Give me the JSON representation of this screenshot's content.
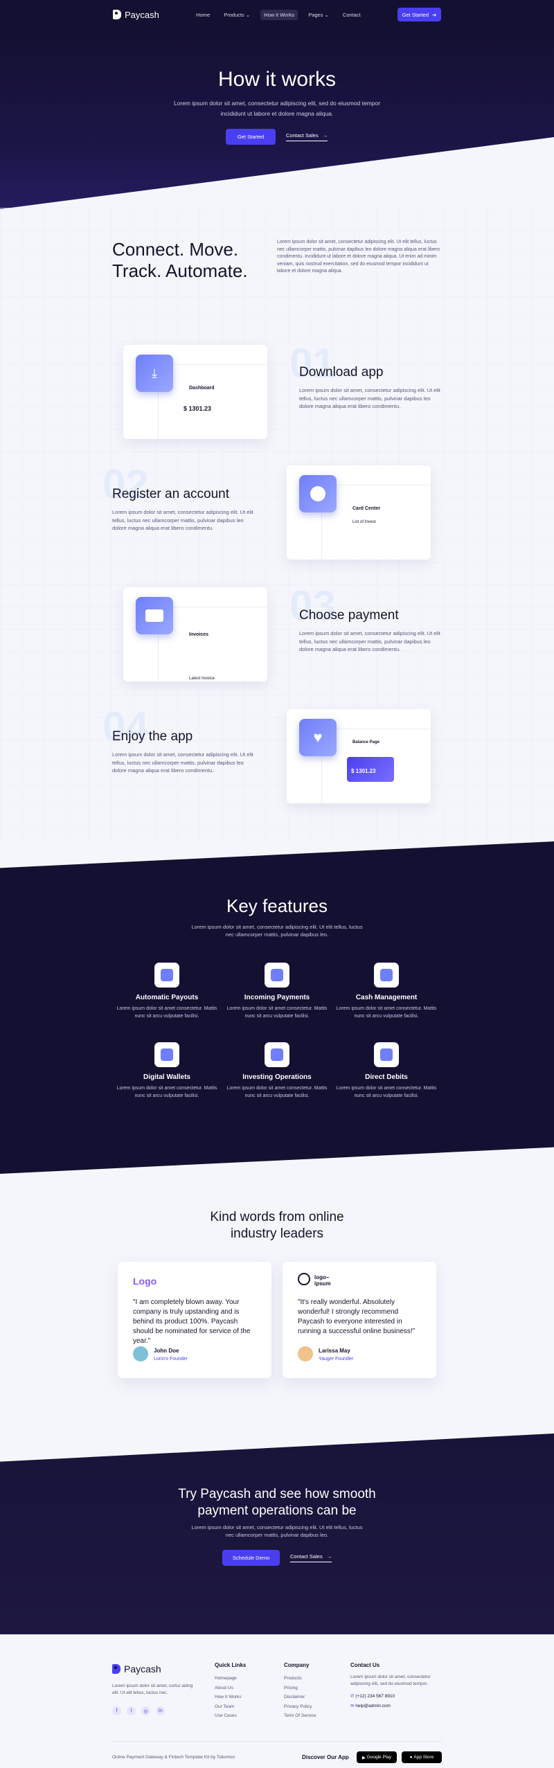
{
  "nav": {
    "brand": "Paycash",
    "items": [
      {
        "label": "Home"
      },
      {
        "label": "Products ⌄"
      },
      {
        "label": "How it Works"
      },
      {
        "label": "Pages ⌄"
      },
      {
        "label": "Contact"
      }
    ],
    "cta": "Get Started"
  },
  "hero": {
    "title": "How it works",
    "subtitle": "Lorem ipsum dolor sit amet, consectetur adipiscing elit, sed do eiusmod tempor incididunt ut labore et dolore magna aliqua.",
    "primary": "Get Started",
    "secondary": "Contact Sales"
  },
  "intro": {
    "title": "Connect. Move. Track. Automate.",
    "text": "Lorem ipsum dolor sit amet, consectetur adipiscing elit. Ut elit tellus, luctus nec ullamcorper mattis, pulvinar dapibus leo dolore magna aliqua erat libero condimentu. Incididunt ut labore et dolore magna aliqua. Ut enim ad minim veniam, quis nostrud exercitation, sed do eiusmod tempor incididunt ut labore et dolore magna aliqua."
  },
  "steps": [
    {
      "num": "01",
      "title": "Download app",
      "text": "Lorem ipsum dolor sit amet, consectetur adipiscing elit. Ut elit tellus, luctus nec ullamcorper mattis, pulvinar dapibus leo dolore magna aliqua erat libero condimentu.",
      "card_title": "Dashboard",
      "card_value": "$ 1301.23"
    },
    {
      "num": "02",
      "title": "Register an account",
      "text": "Lorem ipsum dolor sit amet, consectetur adipiscing elit. Ut elit tellus, luctus nec ullamcorper mattis, pulvinar dapibus leo dolore magna aliqua erat libero condimentu.",
      "card_title": "Card Center",
      "card_value": "List of Invest"
    },
    {
      "num": "03",
      "title": "Choose payment",
      "text": "Lorem ipsum dolor sit amet, consectetur adipiscing elit. Ut elit tellus, luctus nec ullamcorper mattis, pulvinar dapibus leo dolore magna aliqua erat libero condimentu.",
      "card_title": "Invoices",
      "card_value": "Latest Invoice"
    },
    {
      "num": "04",
      "title": "Enjoy the app",
      "text": "Lorem ipsum dolor sit amet, consectetur adipiscing elit. Ut elit tellus, luctus nec ullamcorper mattis, pulvinar dapibus leo dolore magna aliqua erat libero condimentu.",
      "card_title": "Balance Page",
      "card_value": "$ 1301.23"
    }
  ],
  "features": {
    "title": "Key features",
    "subtitle": "Lorem ipsum dolor sit amet, consectetur adipiscing elit. Ut elit tellus, luctus nec ullamcorper mattis, pulvinar dapibus leo.",
    "items": [
      {
        "title": "Automatic Payouts",
        "text": "Lorem ipsum dolor sit amet consectetur. Mattis nunc sit arcu vulputate facilisi."
      },
      {
        "title": "Incoming Payments",
        "text": "Lorem ipsum dolor sit amet consectetur. Mattis nunc sit arcu vulputate facilisi."
      },
      {
        "title": "Cash Management",
        "text": "Lorem ipsum dolor sit amet consectetur. Mattis nunc sit arcu vulputate facilisi."
      },
      {
        "title": "Digital Wallets",
        "text": "Lorem ipsum dolor sit amet consectetur. Mattis nunc sit arcu vulputate facilisi."
      },
      {
        "title": "Investing Operations",
        "text": "Lorem ipsum dolor sit amet consectetur. Mattis nunc sit arcu vulputate facilisi."
      },
      {
        "title": "Direct Debits",
        "text": "Lorem ipsum dolor sit amet consectetur. Mattis nunc sit arcu vulputate facilisi."
      }
    ]
  },
  "testimonials": {
    "title": "Kind words from online industry leaders",
    "items": [
      {
        "logo": "Logo",
        "quote": "\"I am completely blown away. Your company is truly upstanding and is behind its product 100%. Paycash should be nominated for service of the year.\"",
        "name": "John Doe",
        "role": "Loricrs Founder"
      },
      {
        "logo": "logo–ipsum",
        "quote": "\"It's really wonderful. Absolutely wonderful! I strongly recommend Paycash to everyone interested in running a successful online business!\"",
        "name": "Larissa May",
        "role": "Yauger Founder"
      }
    ]
  },
  "cta": {
    "title": "Try Paycash and see how smooth payment operations can be",
    "text": "Lorem ipsum dolor sit amet, consectetur adipiscing elit. Ut elit tellus, luctus nec ullamcorper mattis, pulvinar dapibus leo.",
    "primary": "Schedule Demo",
    "secondary": "Contact Sales"
  },
  "footer": {
    "brand": "Paycash",
    "about": "Lorem ipsum dolor sit amet, cortur ading elit. Ut elit tellus, luctus nec.",
    "cols": [
      {
        "title": "Quick Links",
        "links": [
          "Homepage",
          "About Us",
          "How It Works",
          "Our Team",
          "Use Cases"
        ]
      },
      {
        "title": "Company",
        "links": [
          "Products",
          "Pricing",
          "Disclaimer",
          "Privacy Policy",
          "Term Of Service"
        ]
      }
    ],
    "contact_title": "Contact Us",
    "contact_text": "Lorem ipsum dolor sit amet, consectetur adipiscing elit, sed do eiusmod tempor.",
    "phone": "(+12) 234 567 8910",
    "email": "help@admin.com",
    "copyright": "Online Payment Gateway & Fintech Template Kit by Tokomoo",
    "discover": "Discover Our App",
    "store1": "Google Play",
    "store2": "App Store"
  }
}
